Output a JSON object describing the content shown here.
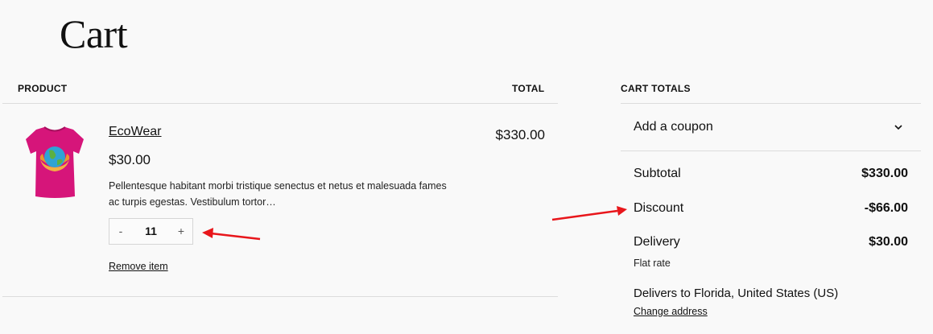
{
  "page": {
    "title": "Cart"
  },
  "cart": {
    "headers": {
      "product": "PRODUCT",
      "total": "TOTAL"
    },
    "item": {
      "name": "EcoWear",
      "price": "$30.00",
      "description": "Pellentesque habitant morbi tristique senectus et netus et malesuada fames ac turpis egestas. Vestibulum tortor…",
      "quantity": "11",
      "qty_minus": "-",
      "qty_plus": "+",
      "line_total": "$330.00",
      "remove_label": "Remove item",
      "image_icon": "tshirt-icon"
    }
  },
  "totals": {
    "header": "CART TOTALS",
    "coupon_label": "Add a coupon",
    "coupon_icon": "chevron-down-icon",
    "subtotal_label": "Subtotal",
    "subtotal_value": "$330.00",
    "discount_label": "Discount",
    "discount_value": "-$66.00",
    "delivery_label": "Delivery",
    "delivery_value": "$30.00",
    "delivery_method": "Flat rate",
    "delivers_to": "Delivers to Florida, United States (US)",
    "change_address": "Change address"
  },
  "colors": {
    "background": "#f9f9f9",
    "annotation_arrow": "#e8161b",
    "tshirt": "#d6157a"
  }
}
